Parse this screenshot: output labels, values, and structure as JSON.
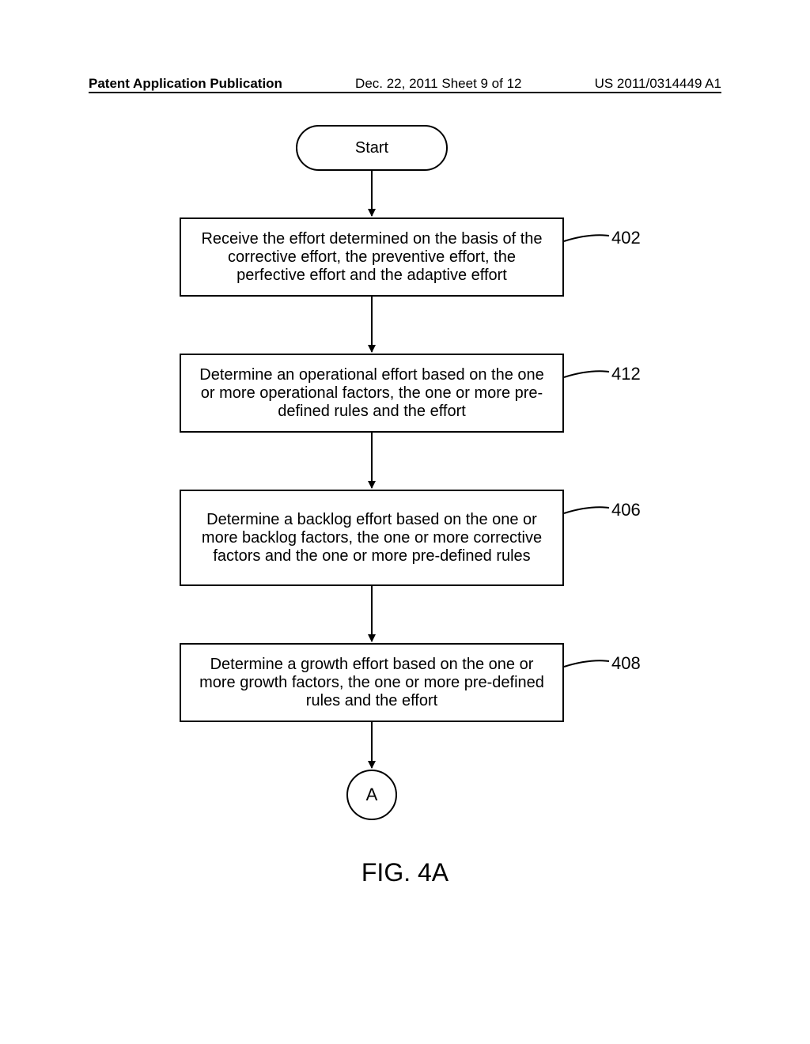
{
  "header": {
    "left": "Patent Application Publication",
    "mid": "Dec. 22, 2011  Sheet 9 of 12",
    "right": "US 2011/0314449 A1"
  },
  "flowchart": {
    "start": "Start",
    "step402": {
      "text": "Receive the effort determined on the basis of the corrective effort, the preventive effort, the perfective effort and the adaptive effort",
      "ref": "402"
    },
    "step412": {
      "text": "Determine an operational effort based on the one or more operational factors, the one or more pre-defined rules and the effort",
      "ref": "412"
    },
    "step406": {
      "text": "Determine a backlog effort based on the one or more backlog factors, the one or more corrective factors and the one or more pre-defined rules",
      "ref": "406"
    },
    "step408": {
      "text": "Determine a growth effort based on the one or more growth factors, the one or more pre-defined rules and the effort",
      "ref": "408"
    },
    "connector": "A"
  },
  "figure_caption": "FIG. 4A"
}
